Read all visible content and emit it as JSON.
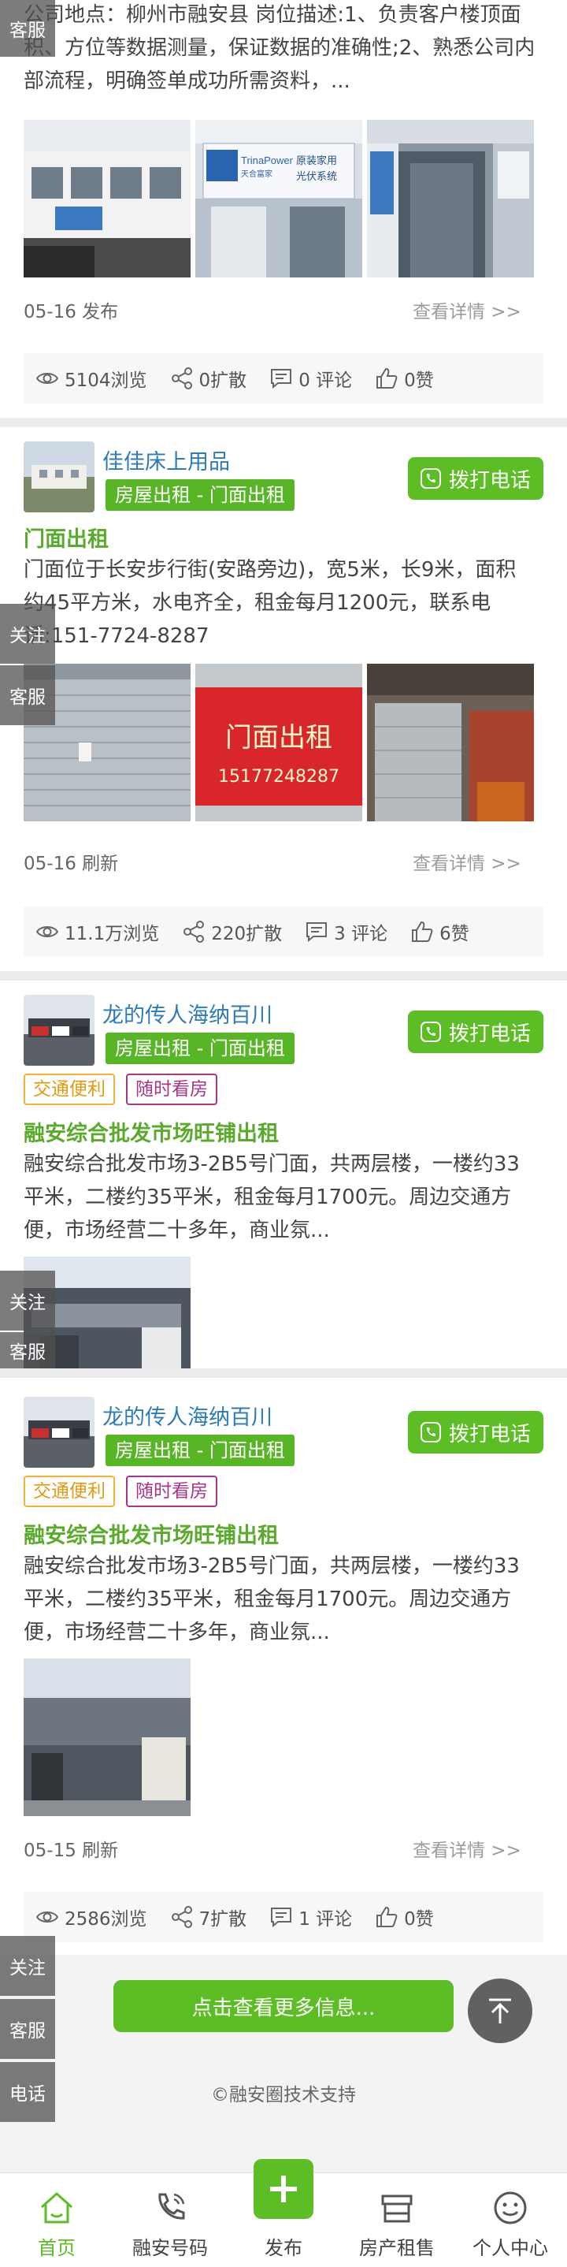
{
  "posts": [
    {
      "desc": "公司地点：柳州市融安县 岗位描述:1、负责客户楼顶面积、方位等数据测量，保证数据的准确性;2、熟悉公司内部流程，明确签单成功所需资料，...",
      "time": "05-16 发布",
      "detail_link": "查看详情 >>",
      "views": "5104浏览",
      "shares": "0扩散",
      "comments": "0 评论",
      "likes": "0赞"
    },
    {
      "poster": "佳佳床上用品",
      "category": "房屋出租 - 门面出租",
      "call": "拨打电话",
      "title": "门面出租",
      "desc": "门面位于长安步行街(安路旁边)，宽5米，长9米，面积约45平方米，水电齐全，租金每月1200元，联系电话:151-7724-8287",
      "photo_sign": "门面出租",
      "photo_phone": "15177248287",
      "time": "05-16 刷新",
      "detail_link": "查看详情 >>",
      "views": "11.1万浏览",
      "shares": "220扩散",
      "comments": "3 评论",
      "likes": "6赞"
    },
    {
      "poster": "龙的传人海纳百川",
      "category": "房屋出租 - 门面出租",
      "call": "拨打电话",
      "badges": [
        "交通便利",
        "随时看房"
      ],
      "title": "融安综合批发市场旺铺出租",
      "desc": "融安综合批发市场3-2B5号门面，共两层楼，一楼约33平米，二楼约35平米，租金每月1700元。周边交通方便，市场经营二十多年，商业氛..."
    },
    {
      "poster": "龙的传人海纳百川",
      "category": "房屋出租 - 门面出租",
      "call": "拨打电话",
      "badges": [
        "交通便利",
        "随时看房"
      ],
      "title": "融安综合批发市场旺铺出租",
      "desc": "融安综合批发市场3-2B5号门面，共两层楼，一楼约33平米，二楼约35平米，租金每月1700元。周边交通方便，市场经营二十多年，商业氛...",
      "time": "05-15 刷新",
      "detail_link": "查看详情 >>",
      "views": "2586浏览",
      "shares": "7扩散",
      "comments": "1 评论",
      "likes": "0赞"
    }
  ],
  "photo_text": {
    "trina_brand": "TrinaPower",
    "trina_sub": "天合富家",
    "trina_line1": "原装家用",
    "trina_line2": "光伏系统"
  },
  "side": {
    "follow": "关注",
    "service": "客服",
    "phone": "电话"
  },
  "more_button": "点击查看更多信息...",
  "support": "©融安圈技术支持",
  "tabs": {
    "home": "首页",
    "numbers": "融安号码",
    "publish": "发布",
    "property": "房产租售",
    "profile": "个人中心"
  },
  "colors": {
    "accent": "#5dbd24",
    "link": "#2e7bb8",
    "title_green": "#5aaa2c"
  }
}
